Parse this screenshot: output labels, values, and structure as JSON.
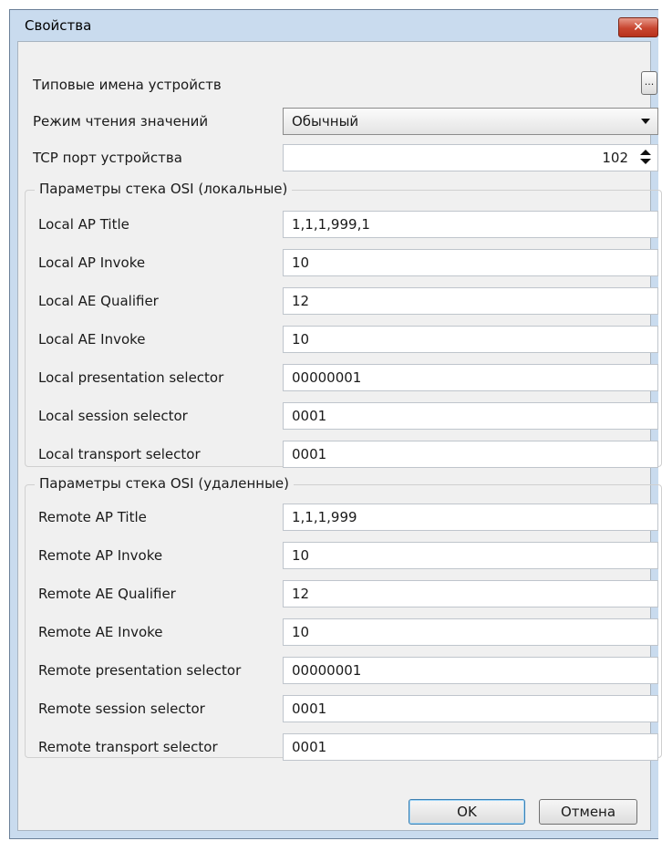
{
  "window": {
    "title": "Свойства",
    "close_glyph": "✕"
  },
  "top": {
    "device_names_label": "Типовые имена устройств",
    "device_names_button": "...",
    "read_mode_label": "Режим чтения значений",
    "read_mode_value": "Обычный",
    "tcp_port_label": "TCP порт устройства",
    "tcp_port_value": "102"
  },
  "local": {
    "legend": "Параметры стека OSI (локальные)",
    "rows": [
      {
        "label": "Local AP Title",
        "value": "1,1,1,999,1"
      },
      {
        "label": "Local AP Invoke",
        "value": "10"
      },
      {
        "label": "Local AE Qualifier",
        "value": "12"
      },
      {
        "label": "Local AE Invoke",
        "value": "10"
      },
      {
        "label": "Local presentation selector",
        "value": "00000001"
      },
      {
        "label": "Local session selector",
        "value": "0001"
      },
      {
        "label": "Local transport selector",
        "value": "0001"
      }
    ]
  },
  "remote": {
    "legend": "Параметры стека OSI (удаленные)",
    "rows": [
      {
        "label": "Remote AP Title",
        "value": "1,1,1,999"
      },
      {
        "label": "Remote AP Invoke",
        "value": "10"
      },
      {
        "label": "Remote AE Qualifier",
        "value": "12"
      },
      {
        "label": "Remote AE Invoke",
        "value": "10"
      },
      {
        "label": "Remote presentation selector",
        "value": "00000001"
      },
      {
        "label": "Remote session selector",
        "value": "0001"
      },
      {
        "label": "Remote transport selector",
        "value": "0001"
      }
    ]
  },
  "buttons": {
    "ok": "OK",
    "cancel": "Отмена"
  },
  "icons": {
    "close": "close-icon",
    "dropdown": "chevron-down-icon",
    "spinner": "spinner-arrows-icon"
  }
}
